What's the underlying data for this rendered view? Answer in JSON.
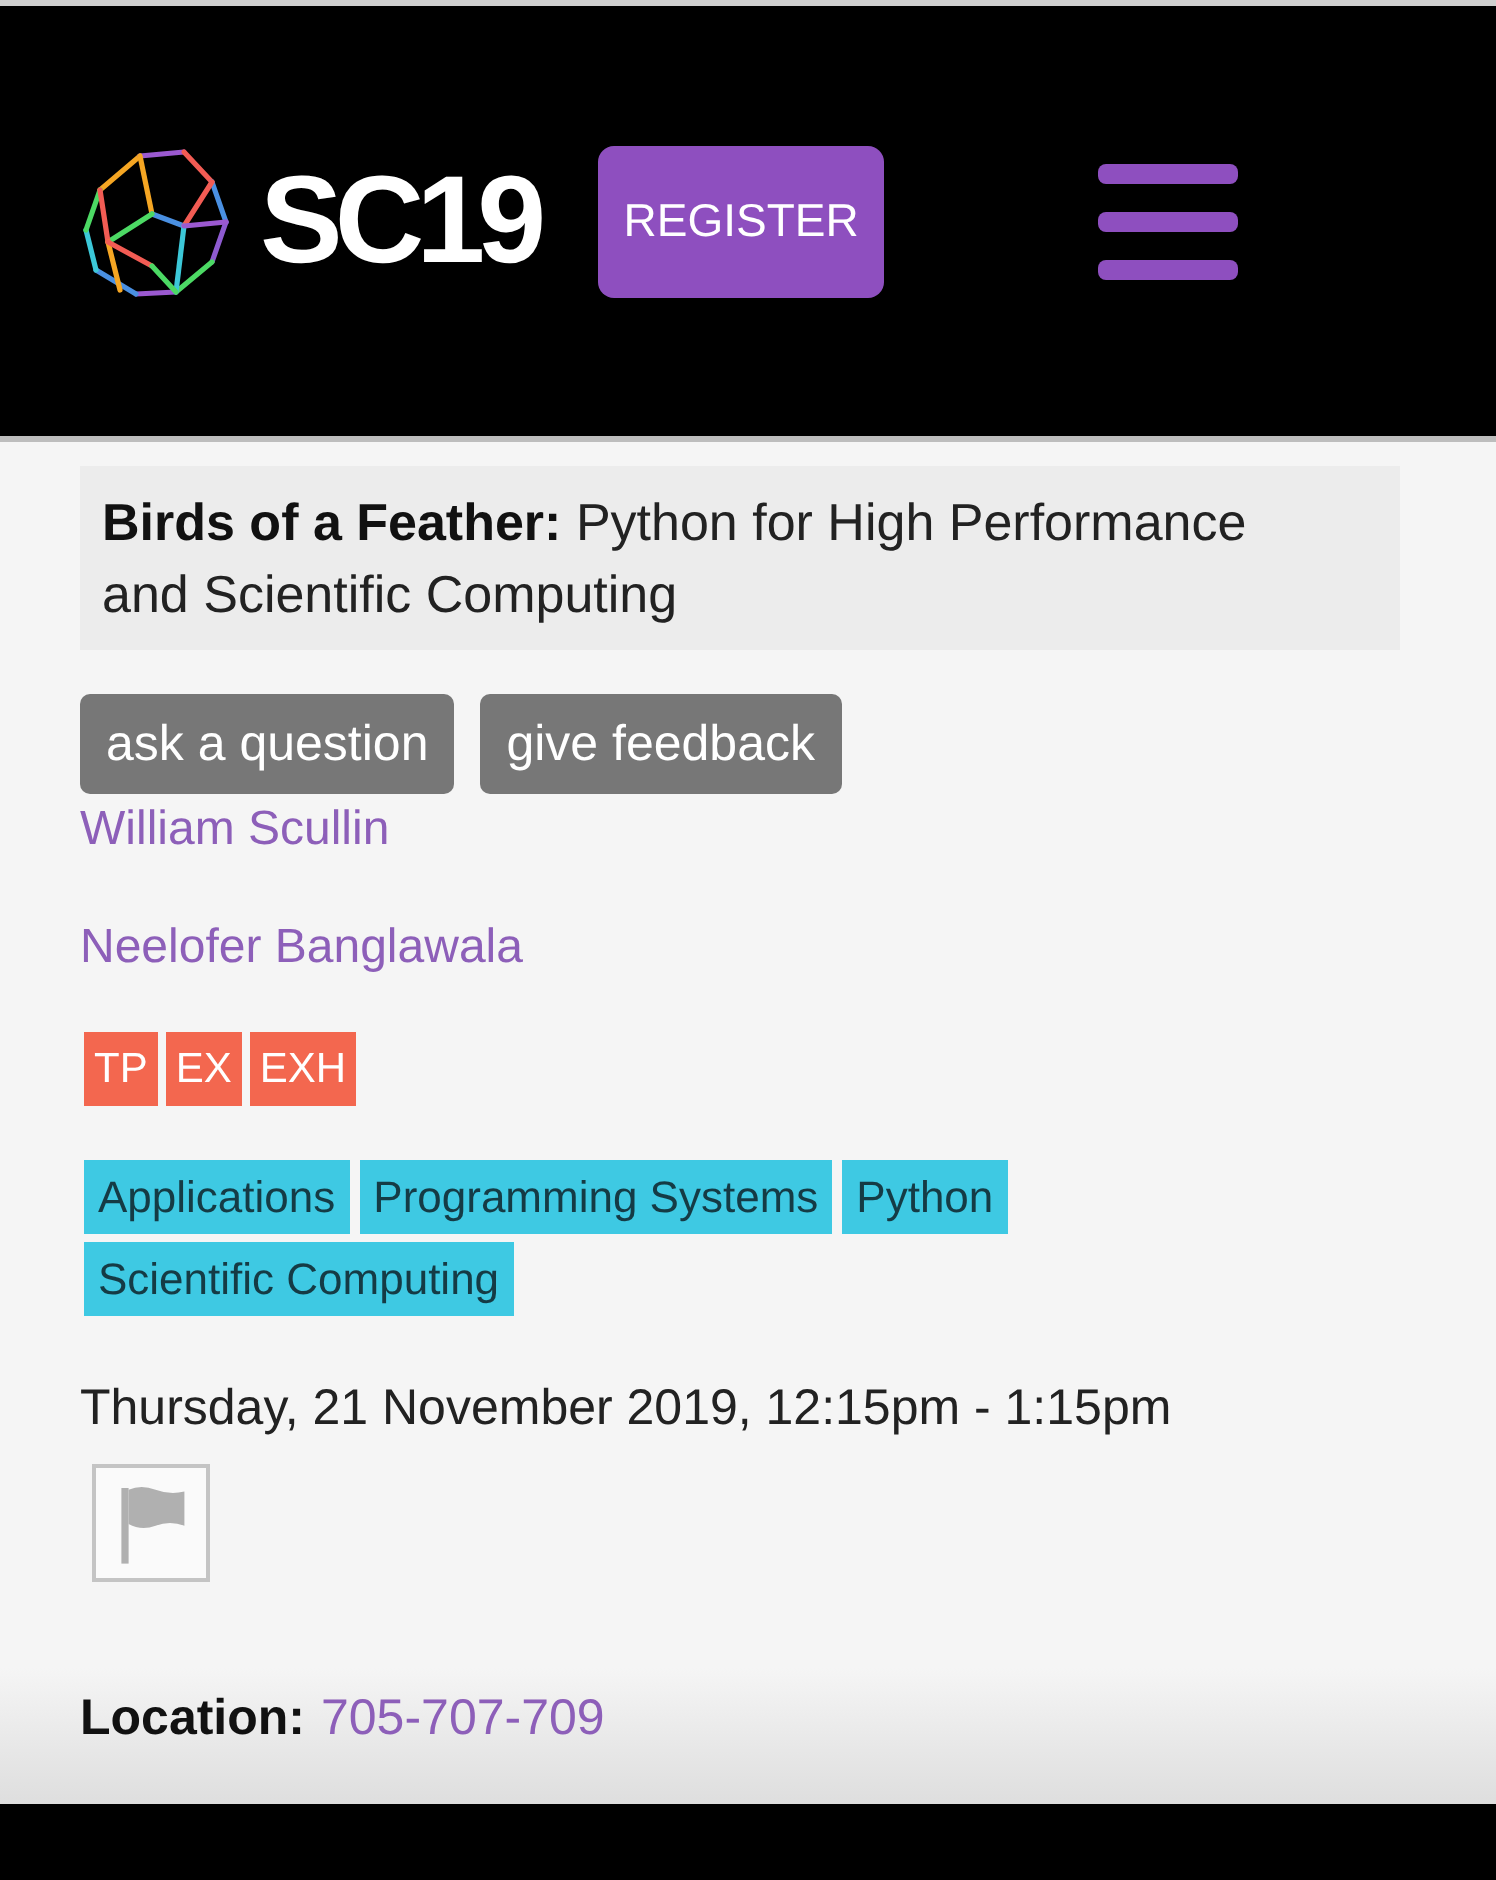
{
  "header": {
    "logo_text": "SC19",
    "register_button": "REGISTER"
  },
  "session": {
    "title": "**Birds of a Feather:** Python for High Performance and Scientific Computing"
  },
  "actions": [
    "ask a question",
    "give feedback"
  ],
  "presenters": [
    "William Scullin",
    "Neelofer Banglawala"
  ],
  "registration_badges": [
    "TP",
    "EX",
    "EXH"
  ],
  "tags": [
    "Applications",
    "Programming Systems",
    "Python",
    "Scientific Computing"
  ],
  "time": "Thursday, 21 November 2019, 12:15pm - 1:15pm",
  "location": {
    "label": "Location:",
    "value": "705-707-709"
  }
}
